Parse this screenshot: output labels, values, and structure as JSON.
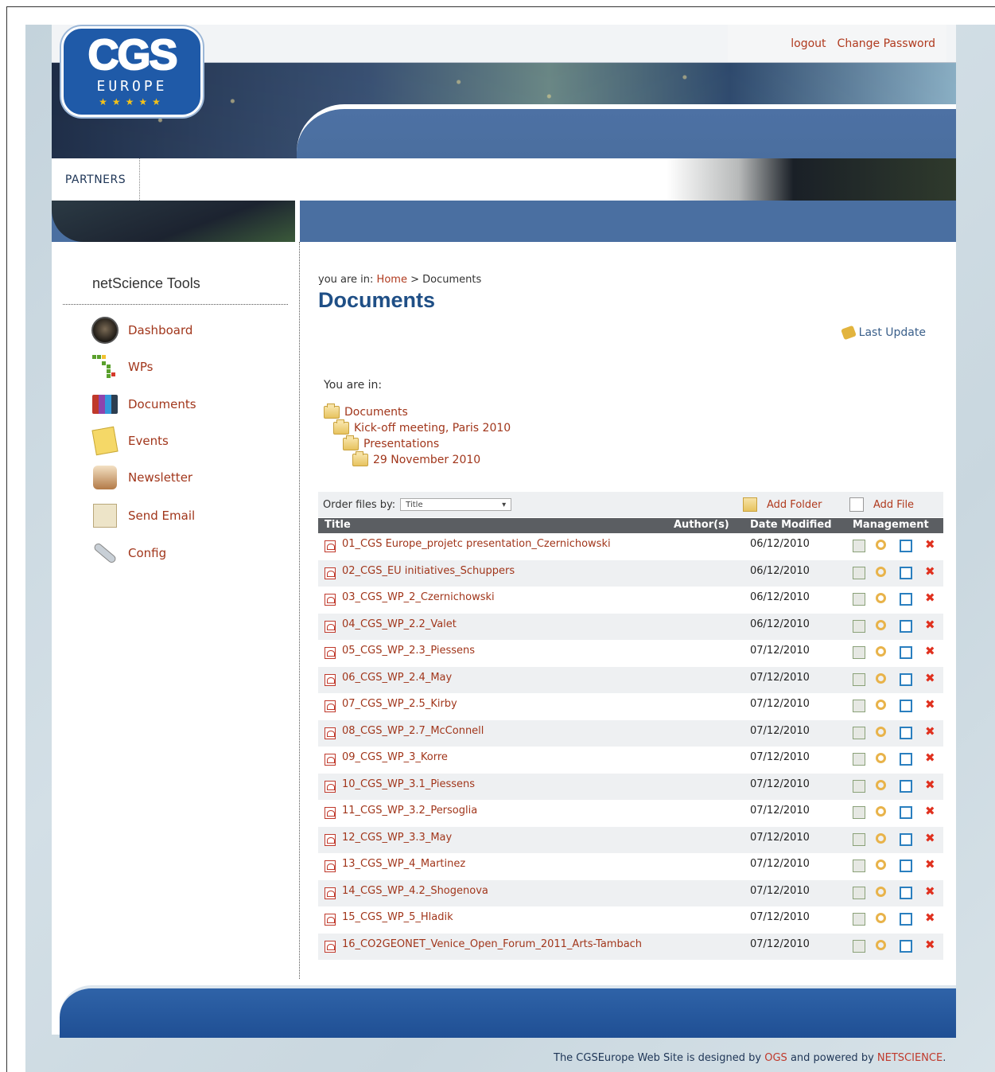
{
  "header": {
    "logo_text": "CGS",
    "logo_sub": "EUROPE",
    "logout": "logout",
    "change_password": "Change Password",
    "nav": [
      "PARTNERS"
    ]
  },
  "sidebar": {
    "title": "netScience Tools",
    "items": [
      {
        "label": "Dashboard",
        "icon": "dashboard-icon"
      },
      {
        "label": "WPs",
        "icon": "wps-icon"
      },
      {
        "label": "Documents",
        "icon": "documents-icon"
      },
      {
        "label": "Events",
        "icon": "events-icon"
      },
      {
        "label": "Newsletter",
        "icon": "newsletter-icon"
      },
      {
        "label": "Send Email",
        "icon": "send-email-icon"
      },
      {
        "label": "Config",
        "icon": "config-icon"
      }
    ]
  },
  "main": {
    "breadcrumb_prefix": "you are in:",
    "breadcrumb_home": "Home",
    "breadcrumb_sep": ">",
    "breadcrumb_current": "Documents",
    "title": "Documents",
    "last_update": "Last Update",
    "you_are_in": "You are in:",
    "folder_tree": [
      "Documents",
      "Kick-off meeting, Paris 2010",
      "Presentations",
      "29 November 2010"
    ],
    "order_label": "Order files by:",
    "order_value": "Title",
    "add_folder": "Add Folder",
    "add_file": "Add File",
    "columns": {
      "title": "Title",
      "authors": "Author(s)",
      "date": "Date Modified",
      "management": "Management"
    },
    "files": [
      {
        "title": "01_CGS Europe_projetc presentation_Czernichowski",
        "date": "06/12/2010"
      },
      {
        "title": "02_CGS_EU initiatives_Schuppers",
        "date": "06/12/2010"
      },
      {
        "title": "03_CGS_WP_2_Czernichowski",
        "date": "06/12/2010"
      },
      {
        "title": "04_CGS_WP_2.2_Valet",
        "date": "06/12/2010"
      },
      {
        "title": "05_CGS_WP_2.3_Piessens",
        "date": "07/12/2010"
      },
      {
        "title": "06_CGS_WP_2.4_May",
        "date": "07/12/2010"
      },
      {
        "title": "07_CGS_WP_2.5_Kirby",
        "date": "07/12/2010"
      },
      {
        "title": "08_CGS_WP_2.7_McConnell",
        "date": "07/12/2010"
      },
      {
        "title": "09_CGS_WP_3_Korre",
        "date": "07/12/2010"
      },
      {
        "title": "10_CGS_WP_3.1_Piessens",
        "date": "07/12/2010"
      },
      {
        "title": "11_CGS_WP_3.2_Persoglia",
        "date": "07/12/2010"
      },
      {
        "title": "12_CGS_WP_3.3_May",
        "date": "07/12/2010"
      },
      {
        "title": "13_CGS_WP_4_Martinez",
        "date": "07/12/2010"
      },
      {
        "title": "14_CGS_WP_4.2_Shogenova",
        "date": "07/12/2010"
      },
      {
        "title": "15_CGS_WP_5_Hladik",
        "date": "07/12/2010"
      },
      {
        "title": "16_CO2GEONET_Venice_Open_Forum_2011_Arts-Tambach",
        "date": "07/12/2010"
      }
    ]
  },
  "footer": {
    "credit_prefix": "The CGSEurope Web Site is designed by",
    "designer": "OGS",
    "credit_mid": "and powered by",
    "powered": "NETSCIENCE",
    "credit_end": "."
  },
  "colors": {
    "accent_link": "#b03a1e",
    "title_blue": "#1f4f86",
    "header_blue": "#4a6fa1"
  }
}
